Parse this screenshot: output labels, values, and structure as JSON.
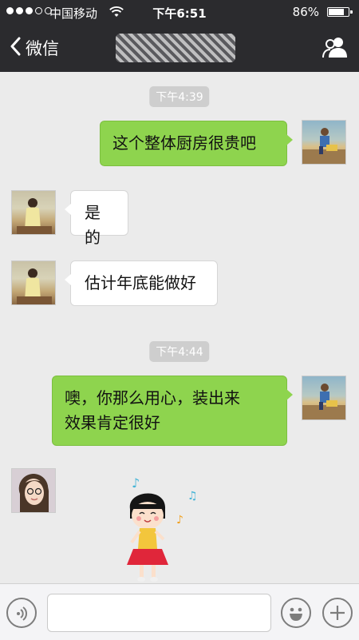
{
  "status_bar": {
    "carrier": "中国移动",
    "time": "下午6:51",
    "battery": "86%",
    "battery_level": 0.86
  },
  "nav": {
    "back_label": "微信",
    "back_icon": "chevron-left-icon",
    "profile_icon": "group-profile-icon",
    "title_obscured": true
  },
  "messages": [
    {
      "type": "timestamp",
      "text": "下午4:39"
    },
    {
      "type": "out",
      "lines": [
        "这个整体厨房很贵吧"
      ],
      "avatar": "boy-avatar"
    },
    {
      "type": "in",
      "lines": [
        "是的"
      ],
      "avatar": "woman-avatar"
    },
    {
      "type": "in",
      "lines": [
        "估计年底能做好"
      ],
      "avatar": "woman-avatar"
    },
    {
      "type": "timestamp",
      "text": "下午4:44"
    },
    {
      "type": "out",
      "lines": [
        "噢，你那么用心，装出来",
        "效果肯定很好"
      ],
      "avatar": "boy-avatar"
    },
    {
      "type": "in-sticker",
      "sticker": "girl-dancing-sticker",
      "avatar": "glasses-woman-avatar"
    }
  ],
  "input_bar": {
    "voice_icon": "voice-icon",
    "emoji_icon": "emoji-icon",
    "plus_icon": "plus-icon",
    "placeholder": ""
  },
  "colors": {
    "header_bg": "#2b2b2e",
    "chat_bg": "#ebebeb",
    "outgoing_bubble": "#8ed44e",
    "incoming_bubble": "#ffffff",
    "timestamp_bg": "#cecece"
  }
}
